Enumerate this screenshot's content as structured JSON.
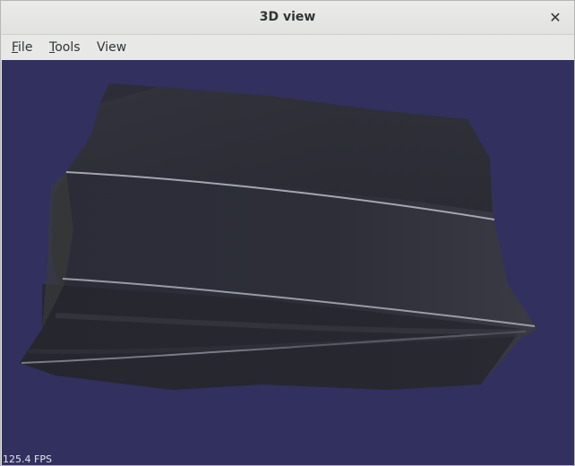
{
  "window": {
    "title": "3D view",
    "close_glyph": "✕"
  },
  "menu": {
    "file": {
      "mnemonic": "F",
      "rest": "ile"
    },
    "tools": {
      "mnemonic": "T",
      "rest": "ools"
    },
    "view": {
      "mnemonic": "",
      "rest": "View"
    }
  },
  "viewport": {
    "background_color": "#31305f",
    "fps_label": "125.4 FPS"
  }
}
